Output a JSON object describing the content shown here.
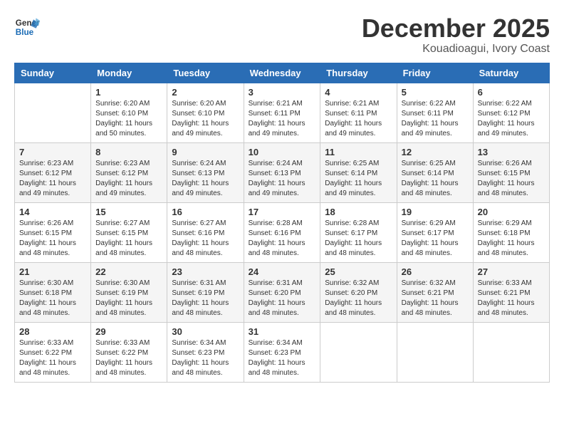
{
  "logo": {
    "line1": "General",
    "line2": "Blue"
  },
  "title": "December 2025",
  "subtitle": "Kouadioagui, Ivory Coast",
  "weekdays": [
    "Sunday",
    "Monday",
    "Tuesday",
    "Wednesday",
    "Thursday",
    "Friday",
    "Saturday"
  ],
  "weeks": [
    [
      {
        "day": "",
        "info": ""
      },
      {
        "day": "1",
        "info": "Sunrise: 6:20 AM\nSunset: 6:10 PM\nDaylight: 11 hours\nand 50 minutes."
      },
      {
        "day": "2",
        "info": "Sunrise: 6:20 AM\nSunset: 6:10 PM\nDaylight: 11 hours\nand 49 minutes."
      },
      {
        "day": "3",
        "info": "Sunrise: 6:21 AM\nSunset: 6:11 PM\nDaylight: 11 hours\nand 49 minutes."
      },
      {
        "day": "4",
        "info": "Sunrise: 6:21 AM\nSunset: 6:11 PM\nDaylight: 11 hours\nand 49 minutes."
      },
      {
        "day": "5",
        "info": "Sunrise: 6:22 AM\nSunset: 6:11 PM\nDaylight: 11 hours\nand 49 minutes."
      },
      {
        "day": "6",
        "info": "Sunrise: 6:22 AM\nSunset: 6:12 PM\nDaylight: 11 hours\nand 49 minutes."
      }
    ],
    [
      {
        "day": "7",
        "info": "Sunrise: 6:23 AM\nSunset: 6:12 PM\nDaylight: 11 hours\nand 49 minutes."
      },
      {
        "day": "8",
        "info": "Sunrise: 6:23 AM\nSunset: 6:12 PM\nDaylight: 11 hours\nand 49 minutes."
      },
      {
        "day": "9",
        "info": "Sunrise: 6:24 AM\nSunset: 6:13 PM\nDaylight: 11 hours\nand 49 minutes."
      },
      {
        "day": "10",
        "info": "Sunrise: 6:24 AM\nSunset: 6:13 PM\nDaylight: 11 hours\nand 49 minutes."
      },
      {
        "day": "11",
        "info": "Sunrise: 6:25 AM\nSunset: 6:14 PM\nDaylight: 11 hours\nand 49 minutes."
      },
      {
        "day": "12",
        "info": "Sunrise: 6:25 AM\nSunset: 6:14 PM\nDaylight: 11 hours\nand 48 minutes."
      },
      {
        "day": "13",
        "info": "Sunrise: 6:26 AM\nSunset: 6:15 PM\nDaylight: 11 hours\nand 48 minutes."
      }
    ],
    [
      {
        "day": "14",
        "info": "Sunrise: 6:26 AM\nSunset: 6:15 PM\nDaylight: 11 hours\nand 48 minutes."
      },
      {
        "day": "15",
        "info": "Sunrise: 6:27 AM\nSunset: 6:15 PM\nDaylight: 11 hours\nand 48 minutes."
      },
      {
        "day": "16",
        "info": "Sunrise: 6:27 AM\nSunset: 6:16 PM\nDaylight: 11 hours\nand 48 minutes."
      },
      {
        "day": "17",
        "info": "Sunrise: 6:28 AM\nSunset: 6:16 PM\nDaylight: 11 hours\nand 48 minutes."
      },
      {
        "day": "18",
        "info": "Sunrise: 6:28 AM\nSunset: 6:17 PM\nDaylight: 11 hours\nand 48 minutes."
      },
      {
        "day": "19",
        "info": "Sunrise: 6:29 AM\nSunset: 6:17 PM\nDaylight: 11 hours\nand 48 minutes."
      },
      {
        "day": "20",
        "info": "Sunrise: 6:29 AM\nSunset: 6:18 PM\nDaylight: 11 hours\nand 48 minutes."
      }
    ],
    [
      {
        "day": "21",
        "info": "Sunrise: 6:30 AM\nSunset: 6:18 PM\nDaylight: 11 hours\nand 48 minutes."
      },
      {
        "day": "22",
        "info": "Sunrise: 6:30 AM\nSunset: 6:19 PM\nDaylight: 11 hours\nand 48 minutes."
      },
      {
        "day": "23",
        "info": "Sunrise: 6:31 AM\nSunset: 6:19 PM\nDaylight: 11 hours\nand 48 minutes."
      },
      {
        "day": "24",
        "info": "Sunrise: 6:31 AM\nSunset: 6:20 PM\nDaylight: 11 hours\nand 48 minutes."
      },
      {
        "day": "25",
        "info": "Sunrise: 6:32 AM\nSunset: 6:20 PM\nDaylight: 11 hours\nand 48 minutes."
      },
      {
        "day": "26",
        "info": "Sunrise: 6:32 AM\nSunset: 6:21 PM\nDaylight: 11 hours\nand 48 minutes."
      },
      {
        "day": "27",
        "info": "Sunrise: 6:33 AM\nSunset: 6:21 PM\nDaylight: 11 hours\nand 48 minutes."
      }
    ],
    [
      {
        "day": "28",
        "info": "Sunrise: 6:33 AM\nSunset: 6:22 PM\nDaylight: 11 hours\nand 48 minutes."
      },
      {
        "day": "29",
        "info": "Sunrise: 6:33 AM\nSunset: 6:22 PM\nDaylight: 11 hours\nand 48 minutes."
      },
      {
        "day": "30",
        "info": "Sunrise: 6:34 AM\nSunset: 6:23 PM\nDaylight: 11 hours\nand 48 minutes."
      },
      {
        "day": "31",
        "info": "Sunrise: 6:34 AM\nSunset: 6:23 PM\nDaylight: 11 hours\nand 48 minutes."
      },
      {
        "day": "",
        "info": ""
      },
      {
        "day": "",
        "info": ""
      },
      {
        "day": "",
        "info": ""
      }
    ]
  ]
}
